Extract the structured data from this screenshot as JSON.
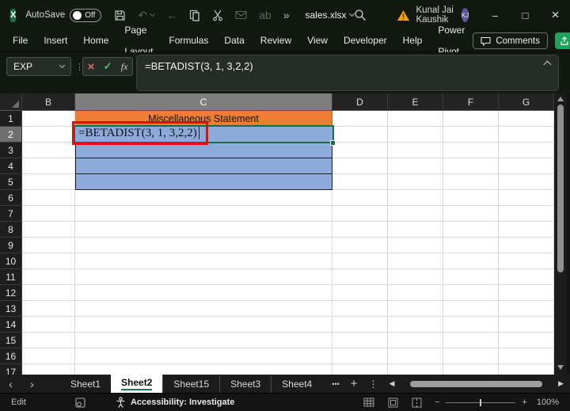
{
  "colors": {
    "theme_dark_green": "#121911",
    "accent_green": "#1a6b47",
    "share_green": "#1ea35d",
    "title_fill_orange": "#ED7D31",
    "range_fill_blue": "#8EAADB",
    "annotation_red": "#DD1111",
    "avatar_purple": "#5C5493",
    "warning_yellow": "#F0A30A"
  },
  "titlebar": {
    "app_letter": "X",
    "autosave_label": "AutoSave",
    "autosave_state": "Off",
    "filename": "sales.xlsx",
    "user_name": "Kunal Jai Kaushik",
    "user_initials": "KJ"
  },
  "ribbon": {
    "tabs": [
      "File",
      "Insert",
      "Home",
      "Page Layout",
      "Formulas",
      "Data",
      "Review",
      "View",
      "Developer",
      "Help",
      "Power Pivot"
    ],
    "comments_label": "Comments"
  },
  "formula_bar": {
    "name_box_value": "EXP",
    "formula": "=BETADIST(3, 1, 3,2,2)"
  },
  "sheet": {
    "columns": [
      "B",
      "C",
      "D",
      "E",
      "F",
      "G"
    ],
    "row_count": 17,
    "selected_column": "C",
    "selected_row": 2,
    "highlighted_range": "C2:C5",
    "cells": {
      "C1": "Miscellaneous Statement",
      "C2": "=BETADIST(3, 1, 3,2,2)"
    }
  },
  "sheet_tabs": {
    "tabs": [
      "Sheet1",
      "Sheet2",
      "Sheet15",
      "Sheet3",
      "Sheet4"
    ],
    "active": "Sheet2"
  },
  "status_bar": {
    "mode": "Edit",
    "accessibility": "Accessibility: Investigate",
    "zoom_level": "100%"
  },
  "icons": {
    "undo": "↶",
    "back": "←",
    "overflow": "»",
    "translate": "ab",
    "minimize": "–",
    "maximize": "□",
    "close": "×",
    "cancel": "×",
    "enter": "✓",
    "fx": "fx",
    "dots": "⋮",
    "nav_left": "‹",
    "nav_right": "›",
    "scroll_left": "◀",
    "scroll_right": "▶",
    "more_sheets": "•••",
    "add_sheet": "+",
    "sheet_menu": "⋮",
    "zoom_out": "−",
    "zoom_in": "+"
  }
}
